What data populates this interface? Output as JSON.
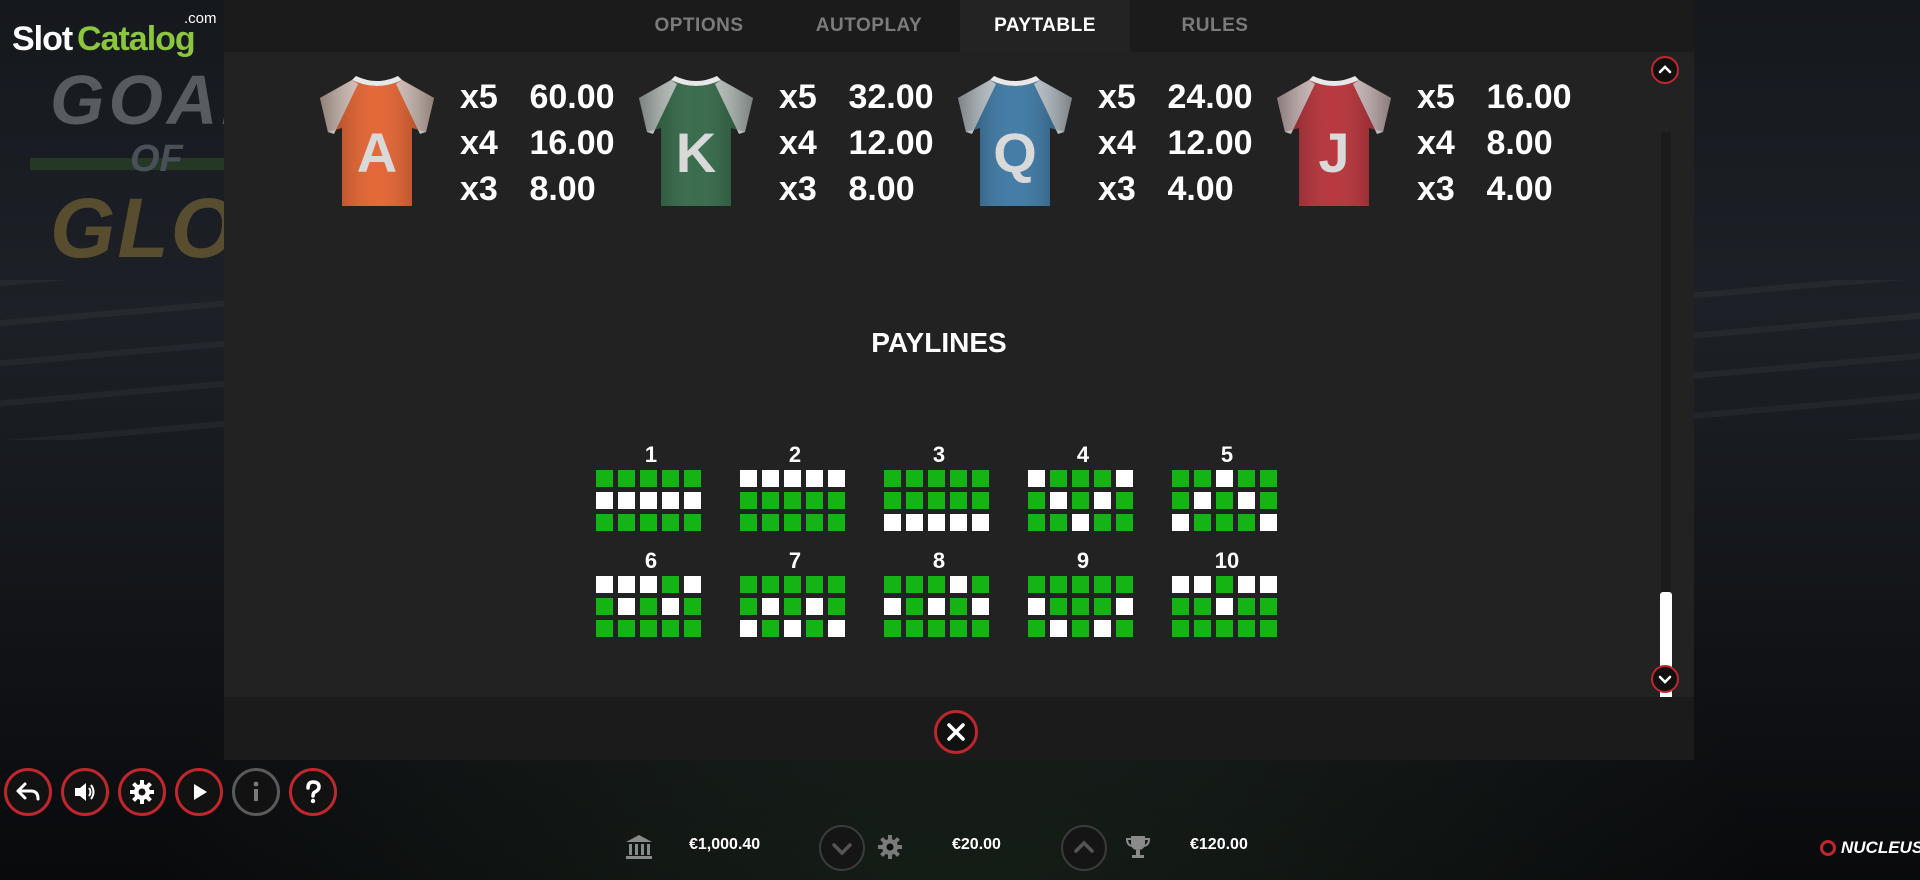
{
  "watermark": {
    "brand_part1": "Slot",
    "brand_part2": "Catalog",
    "domain": ".com"
  },
  "game_logo": {
    "line1": "GOAL",
    "line2": "OF",
    "line3": "GLORY"
  },
  "tabs": [
    {
      "label": "OPTIONS",
      "active": false
    },
    {
      "label": "AUTOPLAY",
      "active": false
    },
    {
      "label": "PAYTABLE",
      "active": true
    },
    {
      "label": "RULES",
      "active": false
    }
  ],
  "symbols": [
    {
      "letter": "A",
      "color": "#e2541c",
      "pays": [
        {
          "mult": "x5",
          "value": "60.00"
        },
        {
          "mult": "x4",
          "value": "16.00"
        },
        {
          "mult": "x3",
          "value": "8.00"
        }
      ]
    },
    {
      "letter": "K",
      "color": "#1f5a36",
      "pays": [
        {
          "mult": "x5",
          "value": "32.00"
        },
        {
          "mult": "x4",
          "value": "12.00"
        },
        {
          "mult": "x3",
          "value": "8.00"
        }
      ]
    },
    {
      "letter": "Q",
      "color": "#2a6c9c",
      "pays": [
        {
          "mult": "x5",
          "value": "24.00"
        },
        {
          "mult": "x4",
          "value": "12.00"
        },
        {
          "mult": "x3",
          "value": "4.00"
        }
      ]
    },
    {
      "letter": "J",
      "color": "#b01d25",
      "pays": [
        {
          "mult": "x5",
          "value": "16.00"
        },
        {
          "mult": "x4",
          "value": "8.00"
        },
        {
          "mult": "x3",
          "value": "4.00"
        }
      ]
    }
  ],
  "paylines_title": "PAYLINES",
  "paylines": [
    {
      "num": "1",
      "rows": [
        [
          0,
          0,
          0,
          0,
          0
        ],
        [
          1,
          1,
          1,
          1,
          1
        ],
        [
          0,
          0,
          0,
          0,
          0
        ]
      ]
    },
    {
      "num": "2",
      "rows": [
        [
          1,
          1,
          1,
          1,
          1
        ],
        [
          0,
          0,
          0,
          0,
          0
        ],
        [
          0,
          0,
          0,
          0,
          0
        ]
      ]
    },
    {
      "num": "3",
      "rows": [
        [
          0,
          0,
          0,
          0,
          0
        ],
        [
          0,
          0,
          0,
          0,
          0
        ],
        [
          1,
          1,
          1,
          1,
          1
        ]
      ]
    },
    {
      "num": "4",
      "rows": [
        [
          1,
          0,
          0,
          0,
          1
        ],
        [
          0,
          1,
          0,
          1,
          0
        ],
        [
          0,
          0,
          1,
          0,
          0
        ]
      ]
    },
    {
      "num": "5",
      "rows": [
        [
          0,
          0,
          1,
          0,
          0
        ],
        [
          0,
          1,
          0,
          1,
          0
        ],
        [
          1,
          0,
          0,
          0,
          1
        ]
      ]
    },
    {
      "num": "6",
      "rows": [
        [
          1,
          1,
          1,
          0,
          1
        ],
        [
          0,
          1,
          0,
          1,
          0
        ],
        [
          0,
          0,
          0,
          0,
          0
        ]
      ]
    },
    {
      "num": "7",
      "rows": [
        [
          0,
          0,
          0,
          0,
          0
        ],
        [
          0,
          1,
          0,
          1,
          0
        ],
        [
          1,
          0,
          1,
          0,
          1
        ]
      ]
    },
    {
      "num": "8",
      "rows": [
        [
          0,
          0,
          0,
          1,
          0
        ],
        [
          1,
          0,
          1,
          0,
          1
        ],
        [
          0,
          0,
          0,
          0,
          0
        ]
      ]
    },
    {
      "num": "9",
      "rows": [
        [
          0,
          0,
          0,
          0,
          0
        ],
        [
          1,
          0,
          0,
          0,
          1
        ],
        [
          0,
          1,
          0,
          1,
          0
        ]
      ]
    },
    {
      "num": "10",
      "rows": [
        [
          1,
          1,
          0,
          1,
          1
        ],
        [
          0,
          0,
          1,
          0,
          0
        ],
        [
          0,
          0,
          0,
          0,
          0
        ]
      ]
    }
  ],
  "colors": {
    "accent_red": "#c0272d",
    "payline_green": "#14b414",
    "payline_white": "#ffffff"
  },
  "controls": [
    {
      "name": "back-button",
      "icon": "back-arrow-icon"
    },
    {
      "name": "sound-button",
      "icon": "speaker-icon"
    },
    {
      "name": "settings-button",
      "icon": "gear-icon"
    },
    {
      "name": "autoplay-button",
      "icon": "play-icon"
    },
    {
      "name": "info-button",
      "icon": "info-icon"
    },
    {
      "name": "help-button",
      "icon": "question-icon"
    }
  ],
  "bottom_bar": {
    "balance": "€1,000.40",
    "bet": "€20.00",
    "win": "€120.00"
  },
  "provider": "NUCLEUS"
}
